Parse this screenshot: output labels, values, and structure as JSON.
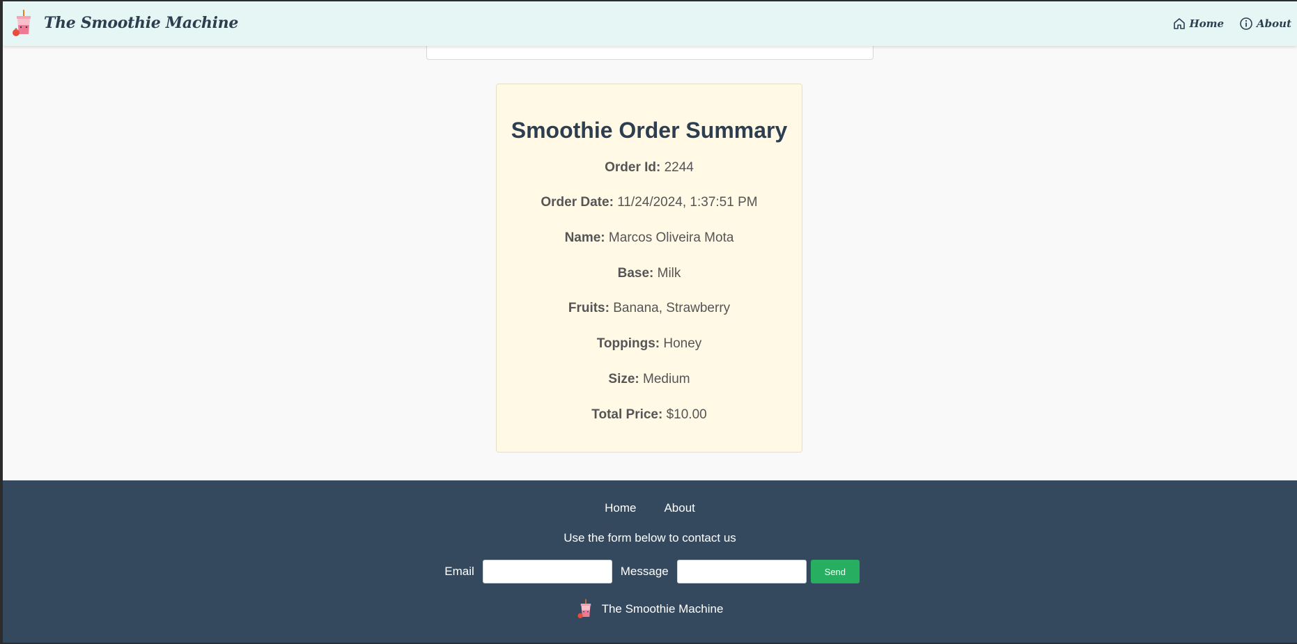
{
  "header": {
    "brand": "The Smoothie Machine",
    "nav": [
      {
        "label": "Home",
        "icon": "home-icon"
      },
      {
        "label": "About",
        "icon": "info-icon"
      }
    ]
  },
  "summary": {
    "title": "Smoothie Order Summary",
    "rows": [
      {
        "label": "Order Id:",
        "value": "2244"
      },
      {
        "label": "Order Date:",
        "value": "11/24/2024, 1:37:51 PM"
      },
      {
        "label": "Name:",
        "value": "Marcos Oliveira Mota"
      },
      {
        "label": "Base:",
        "value": "Milk"
      },
      {
        "label": "Fruits:",
        "value": "Banana, Strawberry"
      },
      {
        "label": "Toppings:",
        "value": "Honey"
      },
      {
        "label": "Size:",
        "value": "Medium"
      },
      {
        "label": "Total Price:",
        "value": "$10.00"
      }
    ]
  },
  "footer": {
    "links": [
      "Home",
      "About"
    ],
    "note": "Use the form below to contact us",
    "email_label": "Email",
    "email_value": "",
    "message_label": "Message",
    "message_value": "",
    "send_label": "Send",
    "brand": "The Smoothie Machine"
  },
  "colors": {
    "header_bg": "#e6f6f4",
    "card_bg": "#fff9e6",
    "footer_bg": "#34495e",
    "send_button": "#27ae60",
    "title_text": "#2c3e50"
  }
}
